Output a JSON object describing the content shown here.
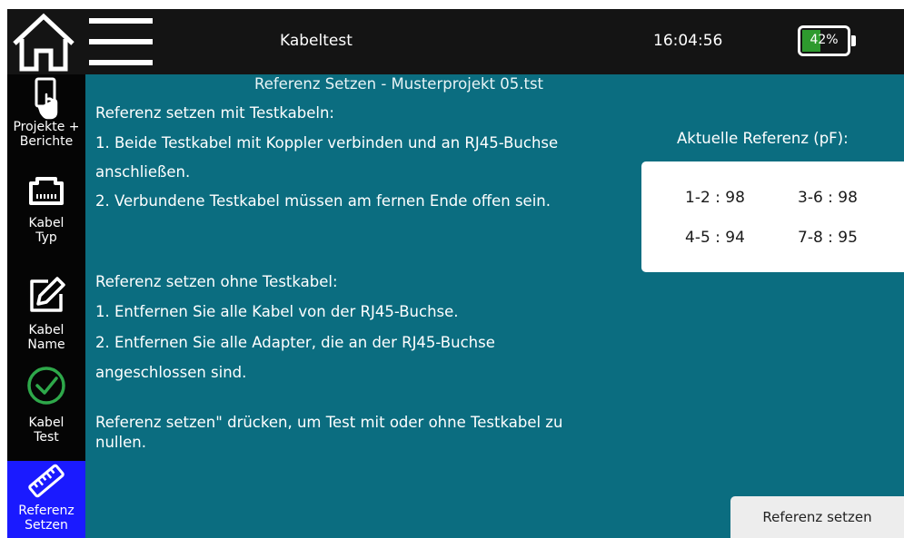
{
  "header": {
    "title": "Kabeltest",
    "time": "16:04:56",
    "battery": {
      "percent_label": "42%",
      "level": 0.42,
      "color": "#2e9a2e"
    }
  },
  "sidebar": {
    "items": [
      {
        "icon": "document-touch-icon",
        "label_line1": "Projekte +",
        "label_line2": "Berichte"
      },
      {
        "icon": "rj45-port-icon",
        "label_line1": "Kabel",
        "label_line2": "Typ"
      },
      {
        "icon": "edit-pencil-icon",
        "label_line1": "Kabel",
        "label_line2": "Name"
      },
      {
        "icon": "check-circle-icon",
        "label_line1": "Kabel",
        "label_line2": "Test",
        "icon_color": "#2ea84a"
      },
      {
        "icon": "ruler-icon",
        "label_line1": "Referenz",
        "label_line2": "Setzen",
        "active": true,
        "active_color": "#1a1aff"
      }
    ]
  },
  "main": {
    "title": "Referenz Setzen - Musterprojekt 05.tst",
    "with_cables_heading": "Referenz setzen mit Testkabeln:",
    "with_cables_step1_line1": "1. Beide Testkabel mit Koppler verbinden und an RJ45-Buchse",
    "with_cables_step1_line2": "anschließen.",
    "with_cables_step2": "2. Verbundene Testkabel müssen am fernen Ende offen sein.",
    "without_cables_heading": "Referenz setzen ohne Testkabel:",
    "without_cables_step1": "1. Entfernen Sie alle Kabel von der RJ45-Buchse.",
    "without_cables_step2_line1": "2. Entfernen Sie alle Adapter, die an der RJ45-Buchse",
    "without_cables_step2_line2": "angeschlossen sind.",
    "instruction_line1": "Referenz setzen\" drücken, um Test mit oder ohne Testkabel zu",
    "instruction_line2": "nullen."
  },
  "reference_panel": {
    "heading": "Aktuelle Referenz (pF):",
    "values": [
      {
        "pair": "1-2",
        "value": 98,
        "text": "1-2 : 98"
      },
      {
        "pair": "3-6",
        "value": 98,
        "text": "3-6 : 98"
      },
      {
        "pair": "4-5",
        "value": 94,
        "text": "4-5 : 94"
      },
      {
        "pair": "7-8",
        "value": 95,
        "text": "7-8 : 95"
      }
    ]
  },
  "actions": {
    "set_reference_label": "Referenz setzen"
  },
  "colors": {
    "background": "#0b6d80",
    "topbar": "#141414",
    "sidebar": "#050505"
  }
}
